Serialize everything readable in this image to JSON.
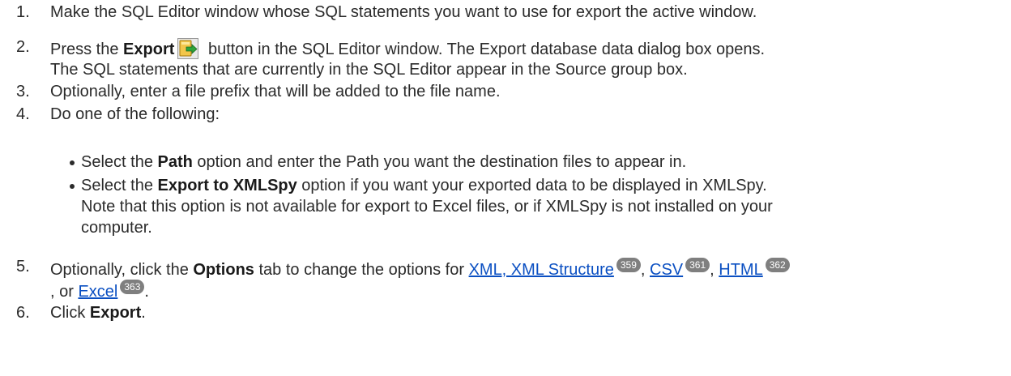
{
  "steps": [
    {
      "num": "1.",
      "text": "Make the SQL Editor window whose SQL statements you want to use for export the active window."
    },
    {
      "num": "2.",
      "pre": "Press the ",
      "bold": "Export",
      "post": " button in the SQL Editor window. The Export database data dialog box opens.",
      "line2": "The SQL statements that are currently in the SQL Editor appear in the Source group box."
    },
    {
      "num": "3.",
      "text": "Optionally, enter a file prefix that will be added to the file name."
    },
    {
      "num": "4.",
      "text": "Do one of the following:"
    },
    {
      "num": "5.",
      "pre": "Optionally, click the ",
      "bold": "Options",
      "post": " tab to change the options for ",
      "links": [
        {
          "text": "XML, XML Structure",
          "page": "359"
        },
        {
          "text": "CSV",
          "page": "361"
        },
        {
          "text": "HTML",
          "page": "362"
        },
        {
          "text": "Excel",
          "page": "363"
        }
      ],
      "sep1": ", ",
      "sep2": ", ",
      "sep3_line2": ", or ",
      "end": "."
    },
    {
      "num": "6.",
      "pre": "Click ",
      "bold": "Export",
      "end": "."
    }
  ],
  "bullets": [
    {
      "pre": "Select the ",
      "bold": "Path",
      "post": " option and enter the Path you want the destination files to appear in."
    },
    {
      "pre": "Select the ",
      "bold": "Export to XMLSpy",
      "post": " option if you want your exported data to be displayed in XMLSpy.",
      "line2": "Note that this option is not available for export to Excel files, or if XMLSpy is not installed on your",
      "line3": "computer."
    }
  ],
  "icons": {
    "export_button": "export-icon"
  },
  "colors": {
    "link": "#0a4fc2",
    "page_badge": "#7f7f7f"
  }
}
